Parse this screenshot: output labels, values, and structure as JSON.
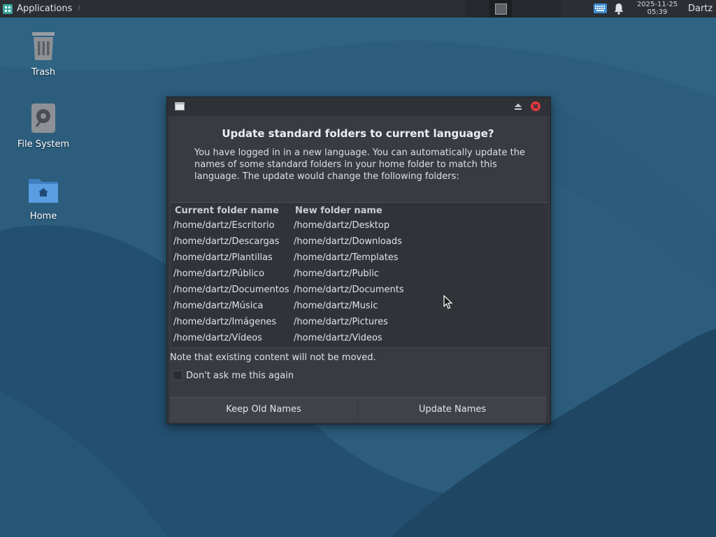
{
  "panel": {
    "applications_label": "Applications",
    "clock_date": "2025-11-25",
    "clock_time": "05:39",
    "user": "Dartz"
  },
  "desktop": {
    "icons": [
      {
        "label": "Trash",
        "icon": "trash-icon"
      },
      {
        "label": "File System",
        "icon": "drive-icon"
      },
      {
        "label": "Home",
        "icon": "home-folder-icon"
      }
    ]
  },
  "dialog": {
    "title": "Update standard folders to current language?",
    "description": "You have logged in in a new language. You can automatically update the names of some standard folders in your home folder to match this language. The update would change the following folders:",
    "columns": [
      "Current folder name",
      "New folder name"
    ],
    "rows": [
      [
        "/home/dartz/Escritorio",
        "/home/dartz/Desktop"
      ],
      [
        "/home/dartz/Descargas",
        "/home/dartz/Downloads"
      ],
      [
        "/home/dartz/Plantillas",
        "/home/dartz/Templates"
      ],
      [
        "/home/dartz/Público",
        "/home/dartz/Public"
      ],
      [
        "/home/dartz/Documentos",
        "/home/dartz/Documents"
      ],
      [
        "/home/dartz/Música",
        "/home/dartz/Music"
      ],
      [
        "/home/dartz/Imágenes",
        "/home/dartz/Pictures"
      ],
      [
        "/home/dartz/Vídeos",
        "/home/dartz/Videos"
      ]
    ],
    "note": "Note that existing content will not be moved.",
    "checkbox_label": "Don't ask me this again",
    "checkbox_checked": false,
    "keep_button": "Keep Old Names",
    "update_button": "Update Names"
  },
  "colors": {
    "panel_bg": "#2b2e33",
    "dialog_bg": "#383c42",
    "close_button": "#e0393e",
    "wallpaper_base": "#2a5a7a"
  }
}
